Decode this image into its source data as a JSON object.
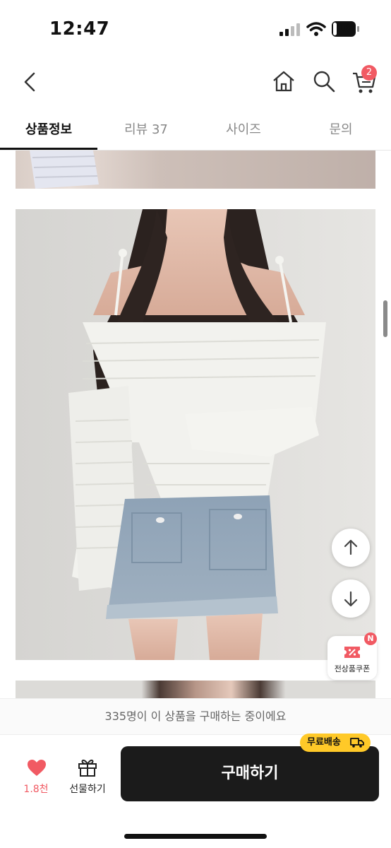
{
  "status": {
    "time": "12:47",
    "battery": "18",
    "battery_level_percent": 18
  },
  "nav": {
    "cart_count": "2"
  },
  "tabs": [
    {
      "label": "상품정보",
      "active": true
    },
    {
      "label": "리뷰 37",
      "active": false
    },
    {
      "label": "사이즈",
      "active": false
    },
    {
      "label": "문의",
      "active": false
    }
  ],
  "coupon": {
    "label": "전상품쿠폰",
    "badge": "N"
  },
  "bottom": {
    "buyers_text": "335명이 이 상품을 구매하는 중이에요",
    "like_count": "1.8천",
    "gift_label": "선물하기",
    "free_shipping": "무료배송",
    "buy_label": "구매하기"
  },
  "colors": {
    "accent_red": "#f15a63",
    "buy_button": "#1b1b1b",
    "shipping_badge": "#ffc928"
  },
  "icons": [
    "back-icon",
    "home-icon",
    "search-icon",
    "cart-icon",
    "arrow-up-icon",
    "arrow-down-icon",
    "coupon-icon",
    "heart-icon",
    "gift-icon",
    "truck-icon"
  ]
}
